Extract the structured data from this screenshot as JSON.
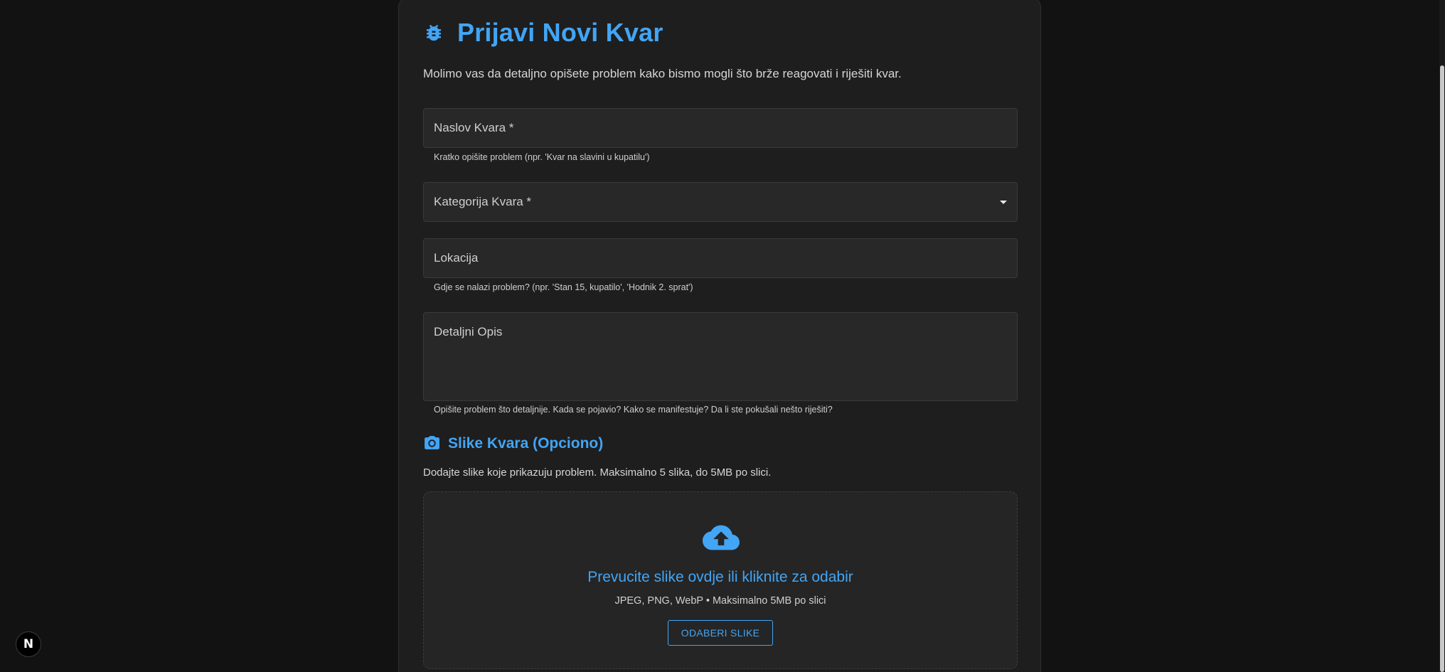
{
  "form": {
    "title": "Prijavi Novi Kvar",
    "title_icon": "bug-icon",
    "intro": "Molimo vas da detaljno opišete problem kako bismo mogli što brže reagovati i riješiti kvar.",
    "fields": {
      "title": {
        "label": "Naslov Kvara *",
        "helper": "Kratko opišite problem (npr. 'Kvar na slavini u kupatilu')"
      },
      "category": {
        "label": "Kategorija Kvara *",
        "icon": "caret-down-icon"
      },
      "location": {
        "label": "Lokacija",
        "helper": "Gdje se nalazi problem? (npr. 'Stan 15, kupatilo', 'Hodnik 2. sprat')"
      },
      "description": {
        "label": "Detaljni Opis",
        "helper": "Opišite problem što detaljnije. Kada se pojavio? Kako se manifestuje? Da li ste pokušali nešto riješiti?"
      }
    },
    "images": {
      "icon": "camera-icon",
      "title": "Slike Kvara (Opciono)",
      "description": "Dodajte slike koje prikazuju problem. Maksimalno 5 slika, do 5MB po slici.",
      "dropzone": {
        "icon": "cloud-upload-icon",
        "main_text": "Prevucite slike ovdje ili kliknite za odabir",
        "sub_text": "JPEG, PNG, WebP • Maksimalno 5MB po slici",
        "button_label": "ODABERI SLIKE"
      }
    }
  },
  "dev_badge": {
    "label": "N",
    "icon": "nextjs-icon"
  },
  "colors": {
    "background": "#121212",
    "card": "#1e1e1e",
    "field": "#282828",
    "accent": "#42a5f5",
    "text": "#e0e0e0"
  }
}
